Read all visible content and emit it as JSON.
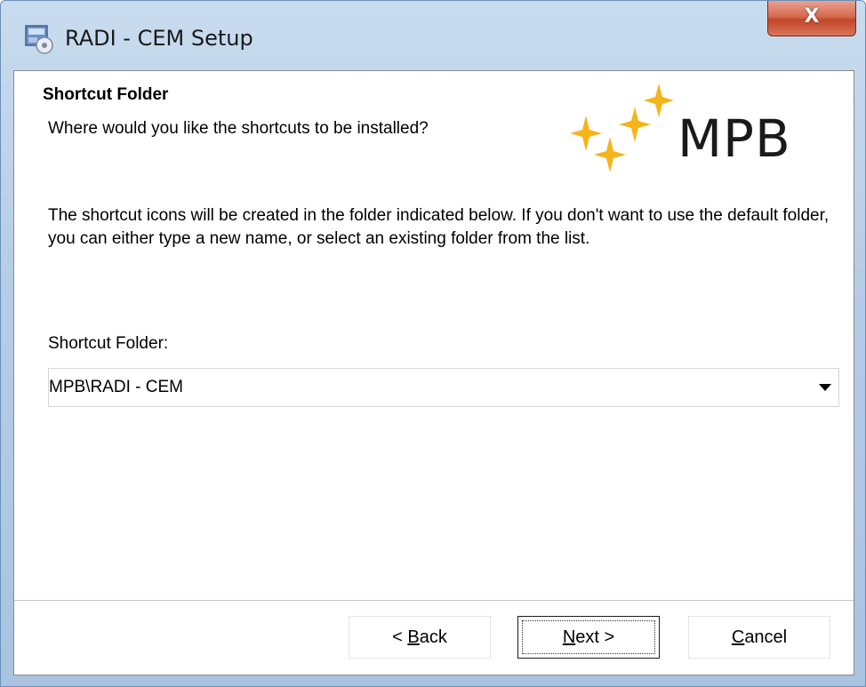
{
  "window": {
    "title": "RADI - CEM Setup",
    "close_glyph": "X"
  },
  "page": {
    "heading": "Shortcut Folder",
    "subheading": "Where would you like the shortcuts to be installed?",
    "description": "The shortcut icons will be created in the folder indicated below. If you don't want to use the default folder, you can either type a new name, or select an existing folder from the list.",
    "logo_text": "MPB"
  },
  "shortcut_folder": {
    "label": "Shortcut Folder:",
    "value": "MPB\\RADI - CEM"
  },
  "buttons": {
    "back": {
      "prefix": "< ",
      "accel": "B",
      "rest": "ack"
    },
    "next": {
      "accel": "N",
      "rest": "ext >"
    },
    "cancel": {
      "accel": "C",
      "rest": "ancel"
    }
  },
  "colors": {
    "logo_star": "#f5b41a",
    "close_button": "#c2462b",
    "title_bar": "#b6cde6"
  },
  "icons": {
    "title": "installer-icon",
    "logo": "sparkle-stars-icon",
    "dropdown": "chevron-down-icon"
  }
}
